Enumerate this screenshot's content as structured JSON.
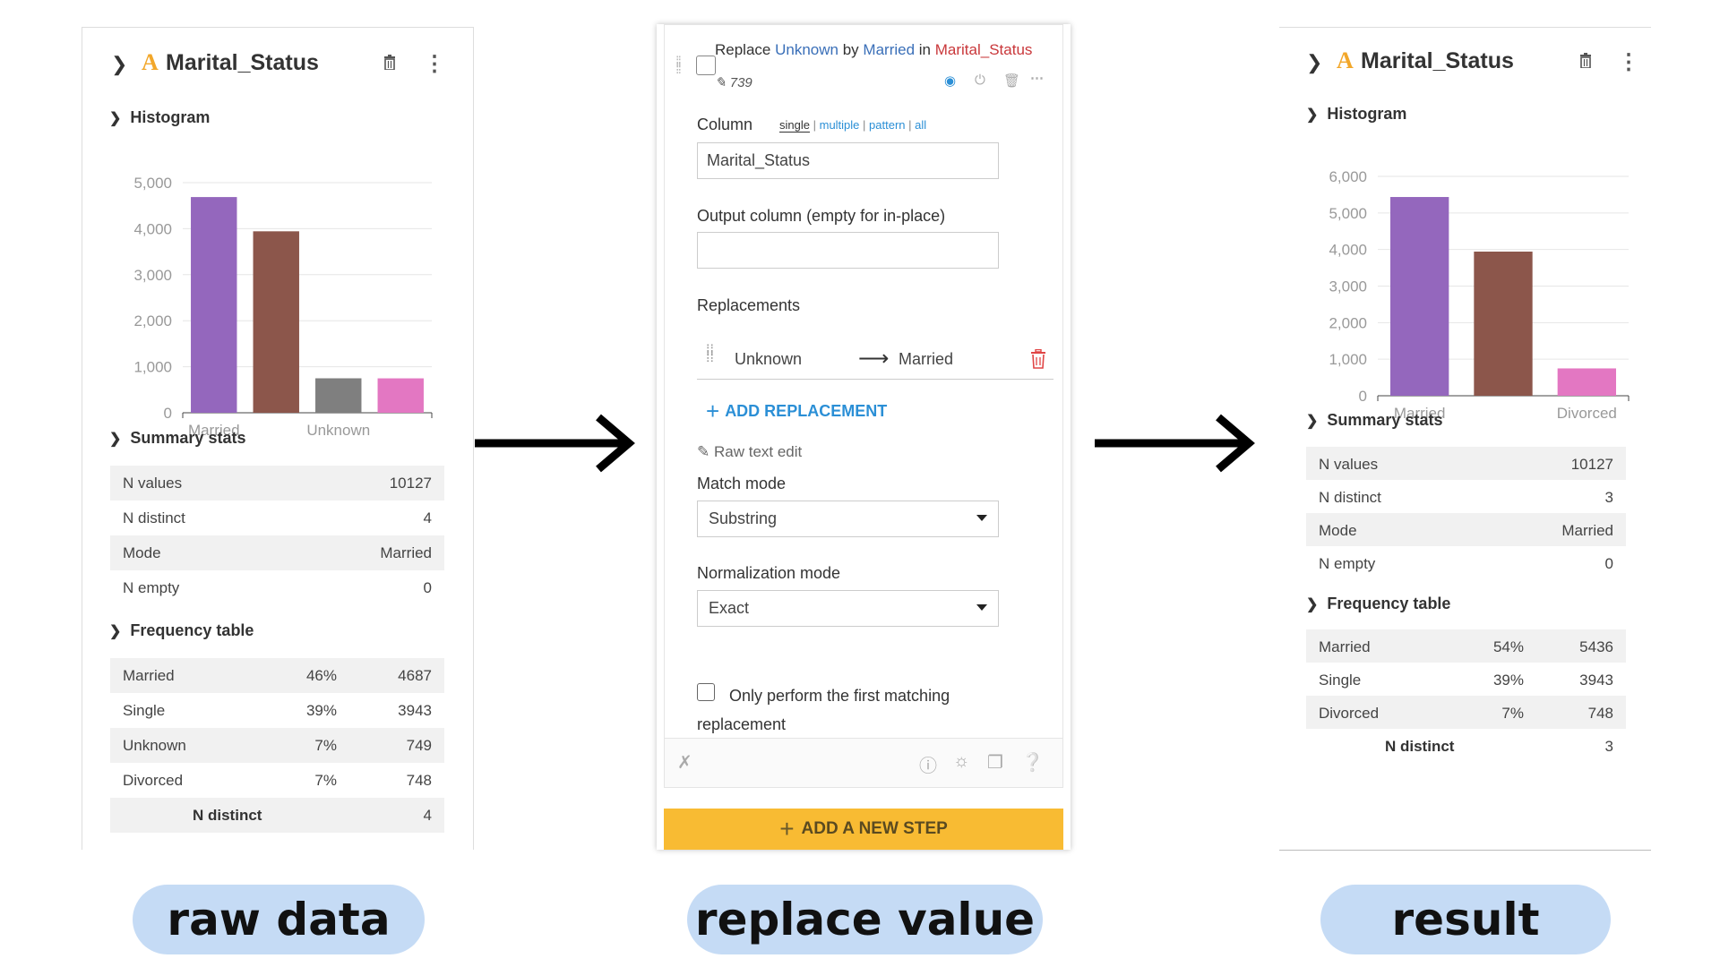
{
  "left": {
    "column_name": "Marital_Status",
    "type_glyph": "A",
    "histogram_title": "Histogram",
    "summary_title": "Summary stats",
    "freq_title": "Frequency table",
    "stats": [
      {
        "label": "N values",
        "value": "10127"
      },
      {
        "label": "N distinct",
        "value": "4"
      },
      {
        "label": "Mode",
        "value": "Married"
      },
      {
        "label": "N empty",
        "value": "0"
      }
    ],
    "freq": [
      {
        "label": "Married",
        "pct": "46%",
        "count": "4687"
      },
      {
        "label": "Single",
        "pct": "39%",
        "count": "3943"
      },
      {
        "label": "Unknown",
        "pct": "7%",
        "count": "749"
      },
      {
        "label": "Divorced",
        "pct": "7%",
        "count": "748"
      }
    ],
    "freq_footer": {
      "label": "N distinct",
      "value": "4"
    }
  },
  "step": {
    "title_word1": "Replace",
    "title_from": "Unknown",
    "title_by": "by",
    "title_to": "Married",
    "title_in": "in",
    "title_col": "Marital_Status",
    "edit_count": "739",
    "column_label": "Column",
    "mode_single": "single",
    "mode_multiple": "multiple",
    "mode_pattern": "pattern",
    "mode_all": "all",
    "mode_sep": "|",
    "column_value": "Marital_Status",
    "output_label": "Output column (empty for in-place)",
    "output_value": "",
    "replacements_label": "Replacements",
    "repl_from": "Unknown",
    "repl_to": "Married",
    "add_replacement": "ADD REPLACEMENT",
    "raw_text_edit": "Raw text edit",
    "match_mode_label": "Match mode",
    "match_mode_value": "Substring",
    "norm_mode_label": "Normalization mode",
    "norm_mode_value": "Exact",
    "first_only_label": "Only perform the first matching replacement",
    "add_step": "ADD A NEW STEP"
  },
  "right": {
    "column_name": "Marital_Status",
    "type_glyph": "A",
    "histogram_title": "Histogram",
    "summary_title": "Summary stats",
    "freq_title": "Frequency table",
    "stats": [
      {
        "label": "N values",
        "value": "10127"
      },
      {
        "label": "N distinct",
        "value": "3"
      },
      {
        "label": "Mode",
        "value": "Married"
      },
      {
        "label": "N empty",
        "value": "0"
      }
    ],
    "freq": [
      {
        "label": "Married",
        "pct": "54%",
        "count": "5436"
      },
      {
        "label": "Single",
        "pct": "39%",
        "count": "3943"
      },
      {
        "label": "Divorced",
        "pct": "7%",
        "count": "748"
      }
    ],
    "freq_footer": {
      "label": "N distinct",
      "value": "3"
    }
  },
  "pills": {
    "left": "raw data",
    "middle": "replace value",
    "right": "result"
  },
  "colors": {
    "bar_purple": "#9467bd",
    "bar_brown": "#8c564b",
    "bar_gray": "#7f7f7f",
    "bar_pink": "#e377c2",
    "accent_blue": "#2b8fd6",
    "add_step_yellow": "#f8bb33",
    "pill_blue": "#c5dbf5"
  },
  "chart_data": [
    {
      "type": "bar",
      "categories": [
        "Married",
        "Single",
        "Unknown",
        "Divorced"
      ],
      "values": [
        4687,
        3943,
        749,
        748
      ],
      "tick_labels_x": [
        "Married",
        "Unknown"
      ],
      "yticks": [
        "0",
        "1,000",
        "2,000",
        "3,000",
        "4,000",
        "5,000"
      ],
      "ylim": [
        0,
        5000
      ],
      "colors": [
        "#9467bd",
        "#8c564b",
        "#7f7f7f",
        "#e377c2"
      ],
      "title": "",
      "xlabel": "",
      "ylabel": ""
    },
    {
      "type": "bar",
      "categories": [
        "Married",
        "Single",
        "Divorced"
      ],
      "values": [
        5436,
        3943,
        748
      ],
      "tick_labels_x": [
        "Married",
        "Divorced"
      ],
      "yticks": [
        "0",
        "1,000",
        "2,000",
        "3,000",
        "4,000",
        "5,000",
        "6,000"
      ],
      "ylim": [
        0,
        6000
      ],
      "colors": [
        "#9467bd",
        "#8c564b",
        "#e377c2"
      ],
      "title": "",
      "xlabel": "",
      "ylabel": ""
    }
  ]
}
